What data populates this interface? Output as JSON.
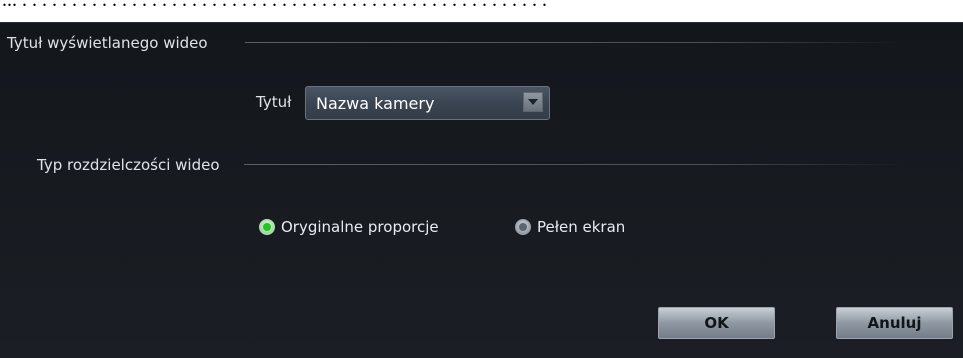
{
  "caption": "... . . . . . . . . . . . . . . . . . . . . . . . . . . . . . . . . . . . . . . . . . . . . . . . . . . . . .",
  "sections": {
    "title_section": "Tytuł wyświetlanego wideo",
    "resolution_section": "Typ rozdzielczości wideo"
  },
  "title_field": {
    "label": "Tytuł",
    "selected": "Nazwa kamery"
  },
  "resolution_options": [
    {
      "label": "Oryginalne proporcje",
      "selected": true
    },
    {
      "label": "Pełen ekran",
      "selected": false
    }
  ],
  "buttons": {
    "ok": "OK",
    "cancel": "Anuluj"
  },
  "colors": {
    "background": "#16191e",
    "radio_selected": "#1ec81e"
  }
}
